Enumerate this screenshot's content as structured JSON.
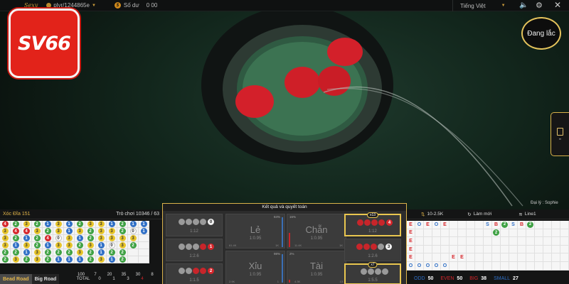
{
  "topbar": {
    "user": "plyr/1244865e",
    "balance_label": "Số dư",
    "balance_value": "0 00",
    "language": "Tiếng Việt"
  },
  "brand": {
    "logo_text": "SV66"
  },
  "shake_button": {
    "label": "Đang lắc"
  },
  "dealer": {
    "label": "Đại lý : Sophie"
  },
  "colors": {
    "accent_gold": "#d9b24a",
    "red": "#d6262b",
    "blue": "#2f6fc6",
    "green": "#3ea143",
    "yellow": "#e7c52b"
  },
  "left_panel": {
    "table": "Xóc Đĩa 151",
    "round": "Trò chơi 10346 / 63",
    "bead_road": [
      [
        [
          "4",
          "red"
        ],
        [
          "3",
          "yellow"
        ],
        [
          "3",
          "yellow"
        ],
        [
          "3",
          "yellow"
        ],
        [
          "2",
          "green"
        ],
        [
          "2",
          "green"
        ]
      ],
      [
        [
          "2",
          "green"
        ],
        [
          "4",
          "red"
        ],
        [
          "2",
          "green"
        ],
        [
          "1",
          "blue"
        ],
        [
          "2",
          "green"
        ],
        [
          "3",
          "yellow"
        ]
      ],
      [
        [
          "3",
          "yellow"
        ],
        [
          "4",
          "red"
        ],
        [
          "1",
          "blue"
        ],
        [
          "3",
          "yellow"
        ],
        [
          "1",
          "blue"
        ],
        [
          "2",
          "green"
        ]
      ],
      [
        [
          "2",
          "green"
        ],
        [
          "3",
          "yellow"
        ],
        [
          "2",
          "green"
        ],
        [
          "2",
          "green"
        ],
        [
          "3",
          "yellow"
        ],
        [
          "3",
          "yellow"
        ]
      ],
      [
        [
          "1",
          "blue"
        ],
        [
          "2",
          "green"
        ],
        [
          "4",
          "red"
        ],
        [
          "1",
          "blue"
        ],
        [
          "2",
          "green"
        ],
        [
          "2",
          "green"
        ]
      ],
      [
        [
          "3",
          "yellow"
        ],
        [
          "3",
          "yellow"
        ],
        [
          "0",
          "white"
        ],
        [
          "3",
          "yellow"
        ],
        [
          "2",
          "green"
        ],
        [
          "1",
          "blue"
        ]
      ],
      [
        [
          "1",
          "blue"
        ],
        [
          "1",
          "blue"
        ],
        [
          "3",
          "yellow"
        ],
        [
          "3",
          "yellow"
        ],
        [
          "2",
          "green"
        ],
        [
          "1",
          "blue"
        ]
      ],
      [
        [
          "2",
          "green"
        ],
        [
          "3",
          "yellow"
        ],
        [
          "1",
          "blue"
        ],
        [
          "2",
          "green"
        ],
        [
          "3",
          "yellow"
        ],
        [
          "1",
          "blue"
        ]
      ],
      [
        [
          "3",
          "yellow"
        ],
        [
          "2",
          "green"
        ],
        [
          "2",
          "green"
        ],
        [
          "3",
          "yellow"
        ],
        [
          "2",
          "green"
        ],
        [
          "2",
          "green"
        ]
      ],
      [
        [
          "3",
          "yellow"
        ],
        [
          "3",
          "yellow"
        ],
        [
          "3",
          "yellow"
        ],
        [
          "1",
          "blue"
        ],
        [
          "1",
          "blue"
        ],
        [
          "3",
          "yellow"
        ]
      ],
      [
        [
          "1",
          "blue"
        ],
        [
          "3",
          "yellow"
        ],
        [
          "3",
          "yellow"
        ],
        [
          "0",
          "white"
        ],
        [
          "2",
          "green"
        ],
        [
          "1",
          "blue"
        ]
      ],
      [
        [
          "2",
          "green"
        ],
        [
          "2",
          "green"
        ],
        [
          "3",
          "yellow"
        ],
        [
          "3",
          "yellow"
        ],
        [
          "2",
          "green"
        ],
        [
          "2",
          "green"
        ]
      ],
      [
        [
          "1",
          "blue"
        ],
        [
          "0",
          "white"
        ],
        [
          "3",
          "yellow"
        ],
        [
          "2",
          "green"
        ],
        [
          "",
          ""
        ],
        [
          "",
          ""
        ]
      ],
      [
        [
          "1",
          "blue"
        ],
        [
          "1",
          "blue"
        ],
        [
          "",
          ""
        ],
        [
          "",
          ""
        ],
        [
          "",
          ""
        ],
        [
          "",
          ""
        ]
      ]
    ],
    "stats_head": [
      "100",
      "7",
      "20",
      "35",
      "30",
      "8"
    ],
    "stats_total_label": "TOTAL",
    "stats_row": [
      "0",
      "1",
      "3",
      "4"
    ],
    "tab_bead": "Bead Road",
    "tab_big": "Big Road"
  },
  "bet_panel": {
    "title": "Kết quả và quyết toán",
    "four_white": {
      "odds": "1:12",
      "count": "0"
    },
    "three_white": {
      "odds": "1:2.6",
      "count": "1"
    },
    "two_two": {
      "odds": "1:1.5",
      "count": "2"
    },
    "le": {
      "label": "Lẻ",
      "odds": "1:0.95",
      "pct": "84%",
      "amt": "61.4K",
      "amt2": "1K"
    },
    "chan": {
      "label": "Chẵn",
      "odds": "1:0.95",
      "pct": "16%",
      "amt": "11.4K",
      "amt2": "1K"
    },
    "xiu": {
      "label": "Xỉu",
      "odds": "1:0.95",
      "pct": "98%",
      "amt": "2.9K",
      "amt2": "1"
    },
    "tai": {
      "label": "Tài",
      "odds": "1:0.95",
      "pct": "2%",
      "amt": "4.3K",
      "amt2": "13"
    },
    "four_red": {
      "odds": "1:12",
      "count": "4",
      "tag": "x13"
    },
    "three_red": {
      "odds": "1:2.6",
      "count": "3"
    },
    "two_white": {
      "odds": "1:5.5",
      "tag": "x7"
    }
  },
  "right_panel": {
    "limit": "10-2.5K",
    "refresh": "Làm mới",
    "line": "Line1",
    "road_left": [
      [
        "E",
        "E",
        "E",
        "E",
        "E",
        "O"
      ],
      [
        "O",
        "",
        "",
        "",
        "",
        "O"
      ],
      [
        "E",
        "",
        "",
        "",
        "",
        "O"
      ],
      [
        "O",
        "",
        "",
        "",
        "",
        "O"
      ],
      [
        "E",
        "",
        "",
        "",
        "",
        "O"
      ],
      [
        "",
        "",
        "",
        "",
        "E",
        ""
      ],
      [
        "",
        "",
        "",
        "",
        "E",
        ""
      ]
    ],
    "road_right": [
      [
        "S",
        "",
        ""
      ],
      [
        "B",
        "2",
        ""
      ],
      [
        "2",
        "",
        ""
      ],
      [
        "S",
        "",
        ""
      ],
      [
        "B",
        "",
        ""
      ],
      [
        "2",
        "",
        ""
      ]
    ],
    "stats": [
      {
        "k": "ODD",
        "v": "50",
        "color": "#2f6fc6"
      },
      {
        "k": "EVEN",
        "v": "50",
        "color": "#d6262b"
      },
      {
        "k": "BIG",
        "v": "38",
        "color": "#d6262b"
      },
      {
        "k": "SMALL",
        "v": "27",
        "color": "#2f6fc6"
      }
    ]
  }
}
